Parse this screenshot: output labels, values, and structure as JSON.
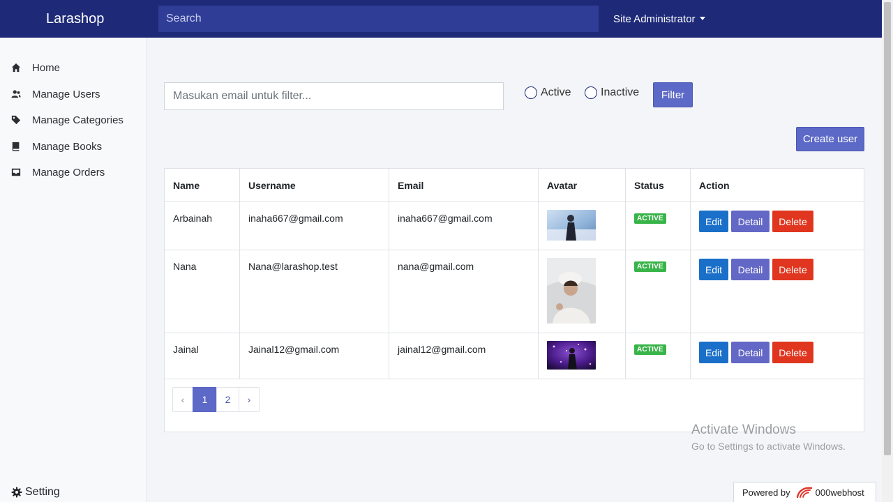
{
  "topbar": {
    "brand": "Larashop",
    "search_placeholder": "Search",
    "user_menu": "Site Administrator",
    "bg_color": "#1e2a78"
  },
  "sidebar": {
    "items": [
      {
        "label": "Home",
        "icon": "home-icon"
      },
      {
        "label": "Manage Users",
        "icon": "users-icon"
      },
      {
        "label": "Manage Categories",
        "icon": "tag-icon"
      },
      {
        "label": "Manage Books",
        "icon": "book-icon"
      },
      {
        "label": "Manage Orders",
        "icon": "inbox-icon"
      }
    ],
    "setting_label": "Setting"
  },
  "filter": {
    "email_placeholder": "Masukan email untuk filter...",
    "radio_active": "Active",
    "radio_inactive": "Inactive",
    "filter_button": "Filter"
  },
  "create_button": "Create user",
  "table": {
    "headers": [
      "Name",
      "Username",
      "Email",
      "Avatar",
      "Status",
      "Action"
    ],
    "rows": [
      {
        "name": "Arbainah",
        "username": "inaha667@gmail.com",
        "email": "inaha667@gmail.com",
        "status": "ACTIVE"
      },
      {
        "name": "Nana",
        "username": "Nana@larashop.test",
        "email": "nana@gmail.com",
        "status": "ACTIVE"
      },
      {
        "name": "Jainal",
        "username": "Jainal12@gmail.com",
        "email": "jainal12@gmail.com",
        "status": "ACTIVE"
      }
    ],
    "actions": {
      "edit": "Edit",
      "detail": "Detail",
      "delete": "Delete"
    }
  },
  "pagination": {
    "prev": "‹",
    "pages": [
      "1",
      "2"
    ],
    "current": "1",
    "next": "›"
  },
  "watermark": {
    "line1": "Activate Windows",
    "line2": "Go to Settings to activate Windows."
  },
  "powered_by": {
    "prefix": "Powered by",
    "brand": "000webhost"
  },
  "colors": {
    "primary": "#5c69c7",
    "edit": "#1a6fc9",
    "delete": "#e0361f",
    "active_badge": "#38b449"
  }
}
